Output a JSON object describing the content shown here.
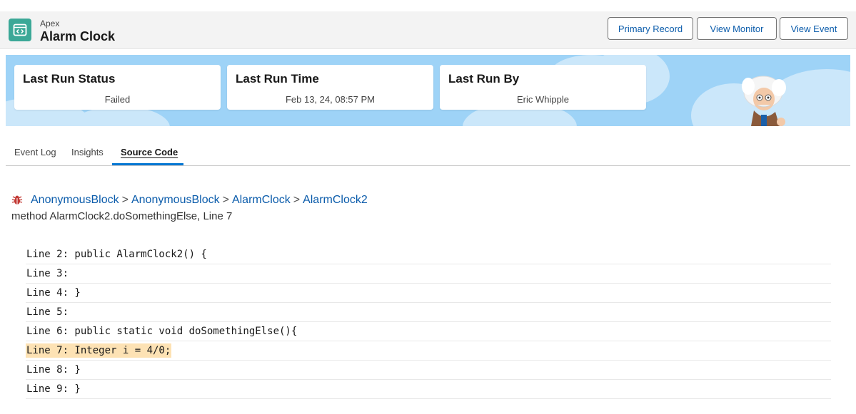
{
  "header": {
    "object_label": "Apex",
    "title": "Alarm Clock",
    "icon": "code-icon",
    "buttons": {
      "primary_record": "Primary Record",
      "view_monitor": "View Monitor",
      "view_event": "View Event"
    }
  },
  "banner": {
    "cards": [
      {
        "title": "Last Run Status",
        "value": "Failed"
      },
      {
        "title": "Last Run Time",
        "value": "Feb 13, 24, 08:57 PM"
      },
      {
        "title": "Last Run By",
        "value": "Eric Whipple"
      }
    ],
    "mascot": "einstein-mascot"
  },
  "tabs": [
    {
      "label": "Event Log",
      "active": false
    },
    {
      "label": "Insights",
      "active": false
    },
    {
      "label": "Source Code",
      "active": true
    }
  ],
  "source": {
    "breadcrumb": [
      "AnonymousBlock",
      "AnonymousBlock",
      "AlarmClock",
      "AlarmClock2"
    ],
    "separator": ">",
    "method_text": "method AlarmClock2.doSomethingElse, Line 7",
    "lines": [
      {
        "text": "Line 2: public AlarmClock2() {",
        "highlight": false
      },
      {
        "text": "Line 3:",
        "highlight": false
      },
      {
        "text": "Line 4: }",
        "highlight": false
      },
      {
        "text": "Line 5:",
        "highlight": false
      },
      {
        "text": "Line 6: public static void doSomethingElse(){",
        "highlight": false
      },
      {
        "text": "Line 7: Integer i = 4/0;",
        "highlight": true
      },
      {
        "text": "Line 8: }",
        "highlight": false
      },
      {
        "text": "Line 9: }",
        "highlight": false
      }
    ]
  },
  "colors": {
    "accent": "#0176d3",
    "link": "#0b5cab",
    "app_icon": "#3ba897",
    "banner": "#9ed3f7",
    "highlight": "#fde2b4",
    "error_icon": "#c23934"
  }
}
